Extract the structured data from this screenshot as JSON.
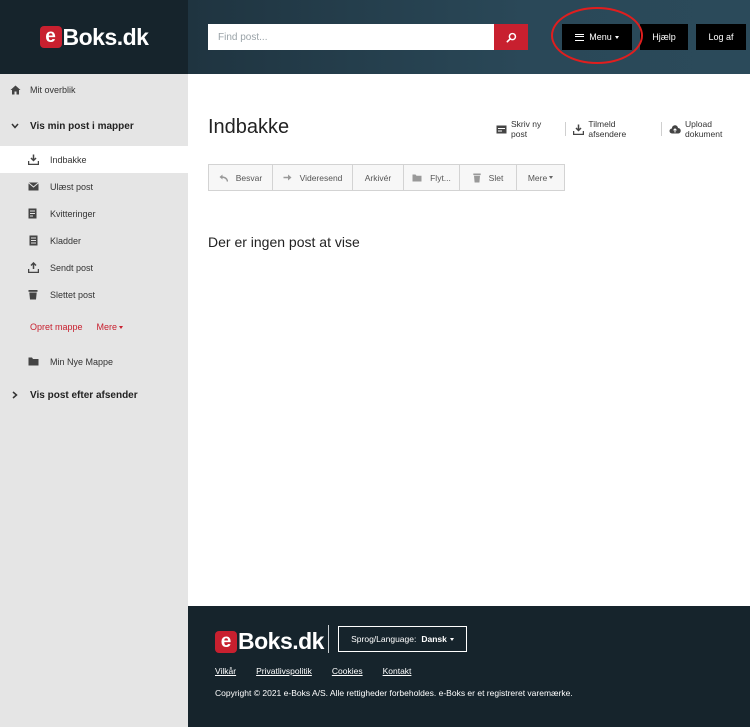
{
  "brand": {
    "logo_letter": "e",
    "logo_text": "Boks.dk"
  },
  "header": {
    "search_placeholder": "Find post...",
    "menu_label": "Menu",
    "help_label": "Hjælp",
    "logout_label": "Log af"
  },
  "sidebar": {
    "overview": "Mit overblik",
    "folders_section": "Vis min post i mapper",
    "items": [
      {
        "label": "Indbakke",
        "icon": "inbox-icon",
        "active": true
      },
      {
        "label": "Ulæst post",
        "icon": "unread-mail-icon",
        "active": false
      },
      {
        "label": "Kvitteringer",
        "icon": "receipt-icon",
        "active": false
      },
      {
        "label": "Kladder",
        "icon": "draft-icon",
        "active": false
      },
      {
        "label": "Sendt post",
        "icon": "sent-icon",
        "active": false
      },
      {
        "label": "Slettet post",
        "icon": "trash-icon",
        "active": false
      }
    ],
    "create_folder": "Opret mappe",
    "more": "Mere",
    "custom_folders": [
      {
        "label": "Min Nye Mappe",
        "icon": "folder-icon"
      }
    ],
    "sender_section": "Vis post efter afsender"
  },
  "main": {
    "title": "Indbakke",
    "actions": [
      {
        "label": "Skriv ny post",
        "icon": "compose-icon"
      },
      {
        "label": "Tilmeld afsendere",
        "icon": "subscribe-icon"
      },
      {
        "label": "Upload dokument",
        "icon": "upload-cloud-icon"
      }
    ],
    "toolbar": {
      "reply": "Besvar",
      "forward": "Videresend",
      "archive": "Arkivér",
      "move": "Flyt...",
      "delete": "Slet",
      "more": "Mere"
    },
    "empty_message": "Der er ingen post at vise"
  },
  "footer": {
    "language_label": "Sprog/Language:",
    "language_value": "Dansk",
    "links": [
      "Vilkår",
      "Privatlivspolitik",
      "Cookies",
      "Kontakt"
    ],
    "copyright": "Copyright © 2021 e-Boks A/S. Alle rettigheder forbeholdes. e-Boks er et registreret varemærke."
  },
  "colors": {
    "brand_red": "#c8202f",
    "dark_navy": "#16242c",
    "sidebar_bg": "#e5e5e5",
    "annotation_red": "#e01e1e"
  }
}
